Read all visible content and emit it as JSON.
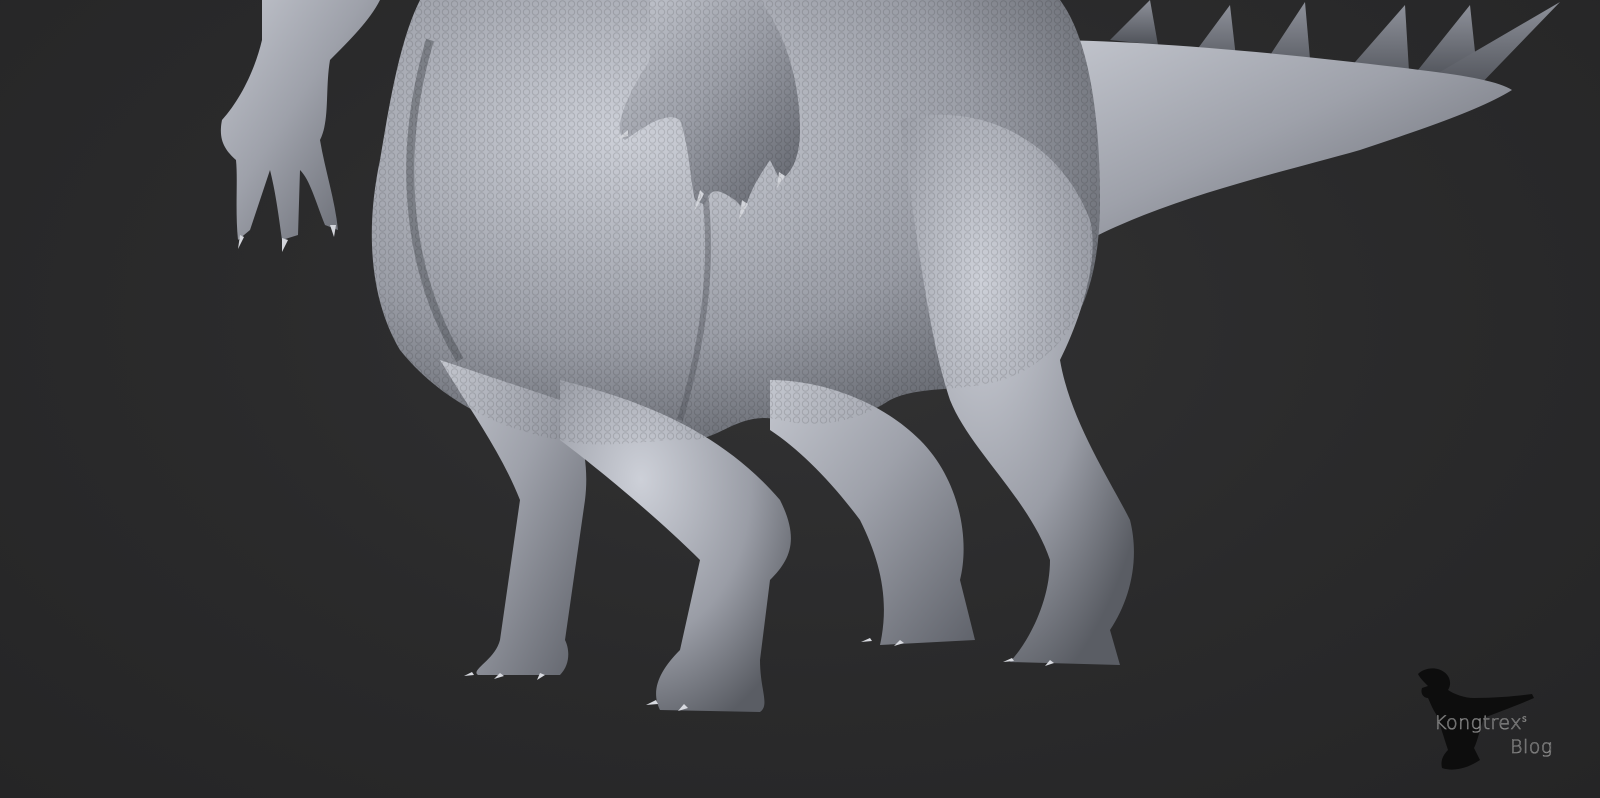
{
  "scene": {
    "subject": "sculpt-render",
    "colors": {
      "background": "#2a2a2b",
      "clay": "#9ea1aa",
      "clay_shadow": "#5e6068",
      "clay_highlight": "#c9ccd4",
      "watermark_outline": "#8f8f8f"
    }
  },
  "watermark": {
    "line1": "Kongtrex",
    "superscript": "s",
    "line2": "Blog",
    "icon": "t-rex-silhouette-icon"
  }
}
